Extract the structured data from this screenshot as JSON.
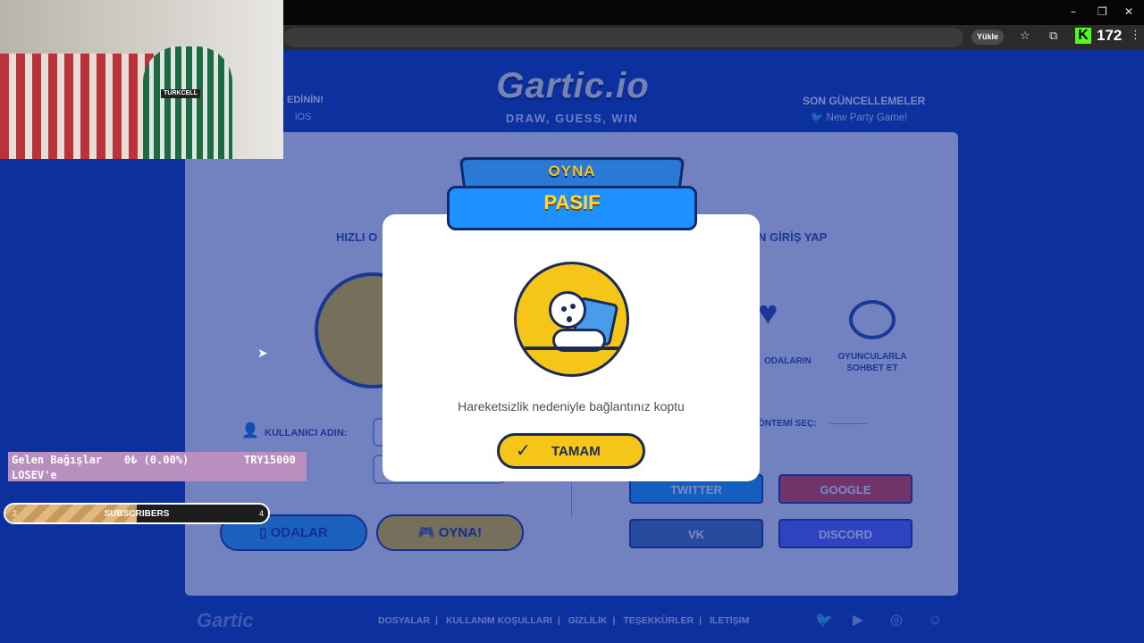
{
  "browser": {
    "window_controls": [
      "–",
      "❐",
      "✕"
    ],
    "install_label": "Yükle",
    "kick_logo": "K",
    "kick_count": "172"
  },
  "game_header": {
    "logo": "Gartic.io",
    "tagline": "DRAW, GUESS, WIN",
    "get_app_label": "EDİNİN!",
    "ios_label": "iOS",
    "updates_title": "SON GÜNCELLEMELER",
    "updates_item": "New Party Game!"
  },
  "panel": {
    "quick_play_label": "HIZLI O",
    "login_label": "N GİRİŞ YAP",
    "rooms_caption": "ODALARIN",
    "chat_caption": "OYUNCULARLA SOHBET ET",
    "username_label": "KULLANICI ADIN:",
    "method_label": "ÖNTEMİ SEÇ:",
    "rooms_button": "ODALAR",
    "play_button": "OYNA!",
    "social": {
      "twitter": "TWITTER",
      "google": "GOOGLE",
      "vk": "VK",
      "discord": "DISCORD"
    }
  },
  "banner": {
    "top_text": "OYNA",
    "main_text": "PASIF"
  },
  "modal": {
    "message": "Hareketsizlik nedeniyle bağlantınız koptu",
    "ok_button": "TAMAM"
  },
  "footer": {
    "logo": "Gartic",
    "links": [
      "DOSYALAR",
      "KULLANIM KOŞULLARI",
      "GİZLİLİK",
      "TEŞEKKÜRLER",
      "İLETİŞİM"
    ],
    "separator": "|"
  },
  "overlays": {
    "donation_title": "Gelen Bağışlar",
    "donation_value": "0₺ (0.00%)",
    "donation_goal": "TRY15000",
    "donation_subtitle": "LOSEV'e",
    "subs_label": "SUBSCRIBERS",
    "subs_min": "2",
    "subs_max": "4",
    "subs_progress": 0.5
  },
  "webcam": {
    "shirt_logo": "TURKCELL"
  },
  "colors": {
    "page_bg": "#0d3aa8",
    "accent_yellow": "#f5c518",
    "accent_blue": "#1e90ff",
    "navy": "#1c2b55"
  }
}
